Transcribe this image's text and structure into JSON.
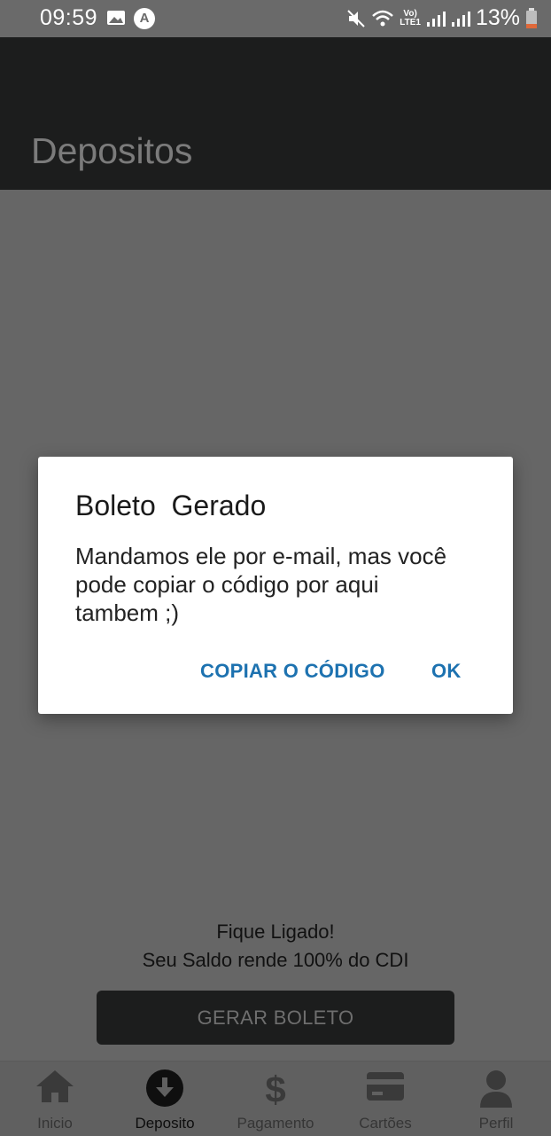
{
  "status_bar": {
    "time": "09:59",
    "battery_percent": "13%",
    "icons": [
      "image-icon",
      "a-icon",
      "mute-icon",
      "wifi-icon",
      "lte-icon",
      "signal-icon",
      "battery-icon"
    ]
  },
  "header": {
    "title": "Depositos"
  },
  "main": {
    "info_line1": "Fique Ligado!",
    "info_line2": "Seu Saldo rende 100% do CDI",
    "generate_button_label": "GERAR BOLETO"
  },
  "dialog": {
    "title": "Boleto  Gerado",
    "message": "Mandamos ele por e-mail, mas você pode copiar o código por aqui tambem ;)",
    "copy_button_label": "COPIAR O CÓDIGO",
    "ok_button_label": "OK"
  },
  "bottom_nav": {
    "items": [
      {
        "label": "Inicio",
        "icon": "home-icon"
      },
      {
        "label": "Deposito",
        "icon": "download-circle-icon",
        "active": true
      },
      {
        "label": "Pagamento",
        "icon": "dollar-icon"
      },
      {
        "label": "Cartões",
        "icon": "credit-card-icon"
      },
      {
        "label": "Perfil",
        "icon": "person-icon"
      }
    ]
  },
  "colors": {
    "accent": "#1d72b0",
    "header_bg": "#1c1d1d",
    "overlay_bg": "#666666"
  }
}
